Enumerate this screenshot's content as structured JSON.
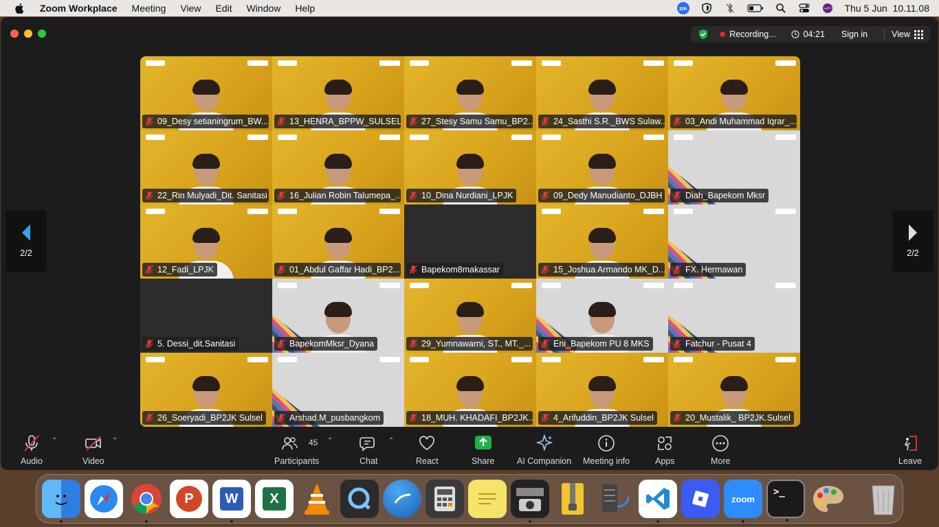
{
  "menubar": {
    "app": "Zoom Workplace",
    "items": [
      "Meeting",
      "View",
      "Edit",
      "Window",
      "Help"
    ],
    "clock": "Thu 5 Jun  10.11.08",
    "zm_badge": "zm"
  },
  "window": {
    "recording_label": "Recording...",
    "timer": "04:21",
    "sign_in": "Sign in",
    "view": "View"
  },
  "gallery": {
    "page_left": "2/2",
    "page_right": "2/2",
    "tiles": [
      {
        "name": "09_Desy setianingrum_BW...",
        "bg": "yellow",
        "person": true
      },
      {
        "name": "13_HENRA_BPPW_SULSEL",
        "bg": "yellow",
        "person": true
      },
      {
        "name": "27_Stesy Samu Samu_BP2...",
        "bg": "yellow",
        "person": true
      },
      {
        "name": "24_Sasthi S.R._BWS Sulaw...",
        "bg": "yellow",
        "person": true
      },
      {
        "name": "03_Andi Muhammad Iqrar_...",
        "bg": "yellow",
        "person": true
      },
      {
        "name": "22_Rin Mulyadi_Dit. Sanitasi",
        "bg": "yellow",
        "person": true
      },
      {
        "name": "16_Julian Robin Talumepa_...",
        "bg": "yellow",
        "person": true
      },
      {
        "name": "10_Dina Nurdiani_LPJK",
        "bg": "yellow",
        "person": true
      },
      {
        "name": "09_Dedy Manudianto_DJBH",
        "bg": "yellow",
        "person": true
      },
      {
        "name": "Diah_Bapekom Mksr",
        "bg": "pattern",
        "person": false,
        "script": "Professional"
      },
      {
        "name": "12_Fadi_LPJK",
        "bg": "yellow",
        "person": true
      },
      {
        "name": "01_Abdul Gaffar Hadi_BP2...",
        "bg": "yellow",
        "person": true
      },
      {
        "name": "Bapekom8makassar",
        "bg": "dark",
        "person": false
      },
      {
        "name": "15_Joshua Armando MK_D...",
        "bg": "yellow",
        "person": true
      },
      {
        "name": "FX. Hermawan",
        "bg": "pattern",
        "person": false,
        "script": "Professional"
      },
      {
        "name": "5. Dessi_dit.Sanitasi",
        "bg": "dark",
        "person": false
      },
      {
        "name": "BapekomMksr_Dyana",
        "bg": "pattern",
        "person": true,
        "script": "Professional"
      },
      {
        "name": "29_Yumnawarni, ST., MT._...",
        "bg": "yellow",
        "person": true
      },
      {
        "name": "Eni_Bapekom PU 8 MKS",
        "bg": "pattern",
        "person": true
      },
      {
        "name": "Fatchur - Pusat 4",
        "bg": "pattern",
        "person": false,
        "script": "Professional"
      },
      {
        "name": "26_Soeryadi_BP2JK Sulsel",
        "bg": "yellow",
        "person": true
      },
      {
        "name": "Arshad.M_pusbangkom",
        "bg": "pattern",
        "person": false,
        "script": "Professional"
      },
      {
        "name": "18_MUH. KHADAFI_BP2JK...",
        "bg": "yellow",
        "person": true
      },
      {
        "name": "4_Arifuddin_BP2JK Sulsel",
        "bg": "yellow",
        "person": true
      },
      {
        "name": "20_Mustalik_ BP2JK.Sulsel",
        "bg": "yellow",
        "person": true
      }
    ]
  },
  "toolbar": {
    "audio": "Audio",
    "video": "Video",
    "participants": "Participants",
    "participants_count": "45",
    "chat": "Chat",
    "react": "React",
    "share": "Share",
    "ai_companion": "AI Companion",
    "meeting_info": "Meeting info",
    "apps": "Apps",
    "more": "More",
    "leave": "Leave"
  },
  "dock": {
    "apps": [
      "finder-icon",
      "safari-icon",
      "chrome-icon",
      "powerpoint-icon",
      "word-icon",
      "excel-icon",
      "vlc-icon",
      "quicktime-icon",
      "mikrotik-icon",
      "calculator-icon",
      "stickies-icon",
      "photo-booth-icon",
      "archive-utility-icon",
      "network-utility-icon",
      "vscode-icon",
      "roblox-icon",
      "zoom-icon",
      "terminal-icon",
      "color-palette-icon",
      "trash-icon"
    ],
    "labels": {
      "powerpoint": "P",
      "word": "W",
      "excel": "X",
      "zoom": "zoom",
      "terminal": ">_"
    }
  }
}
